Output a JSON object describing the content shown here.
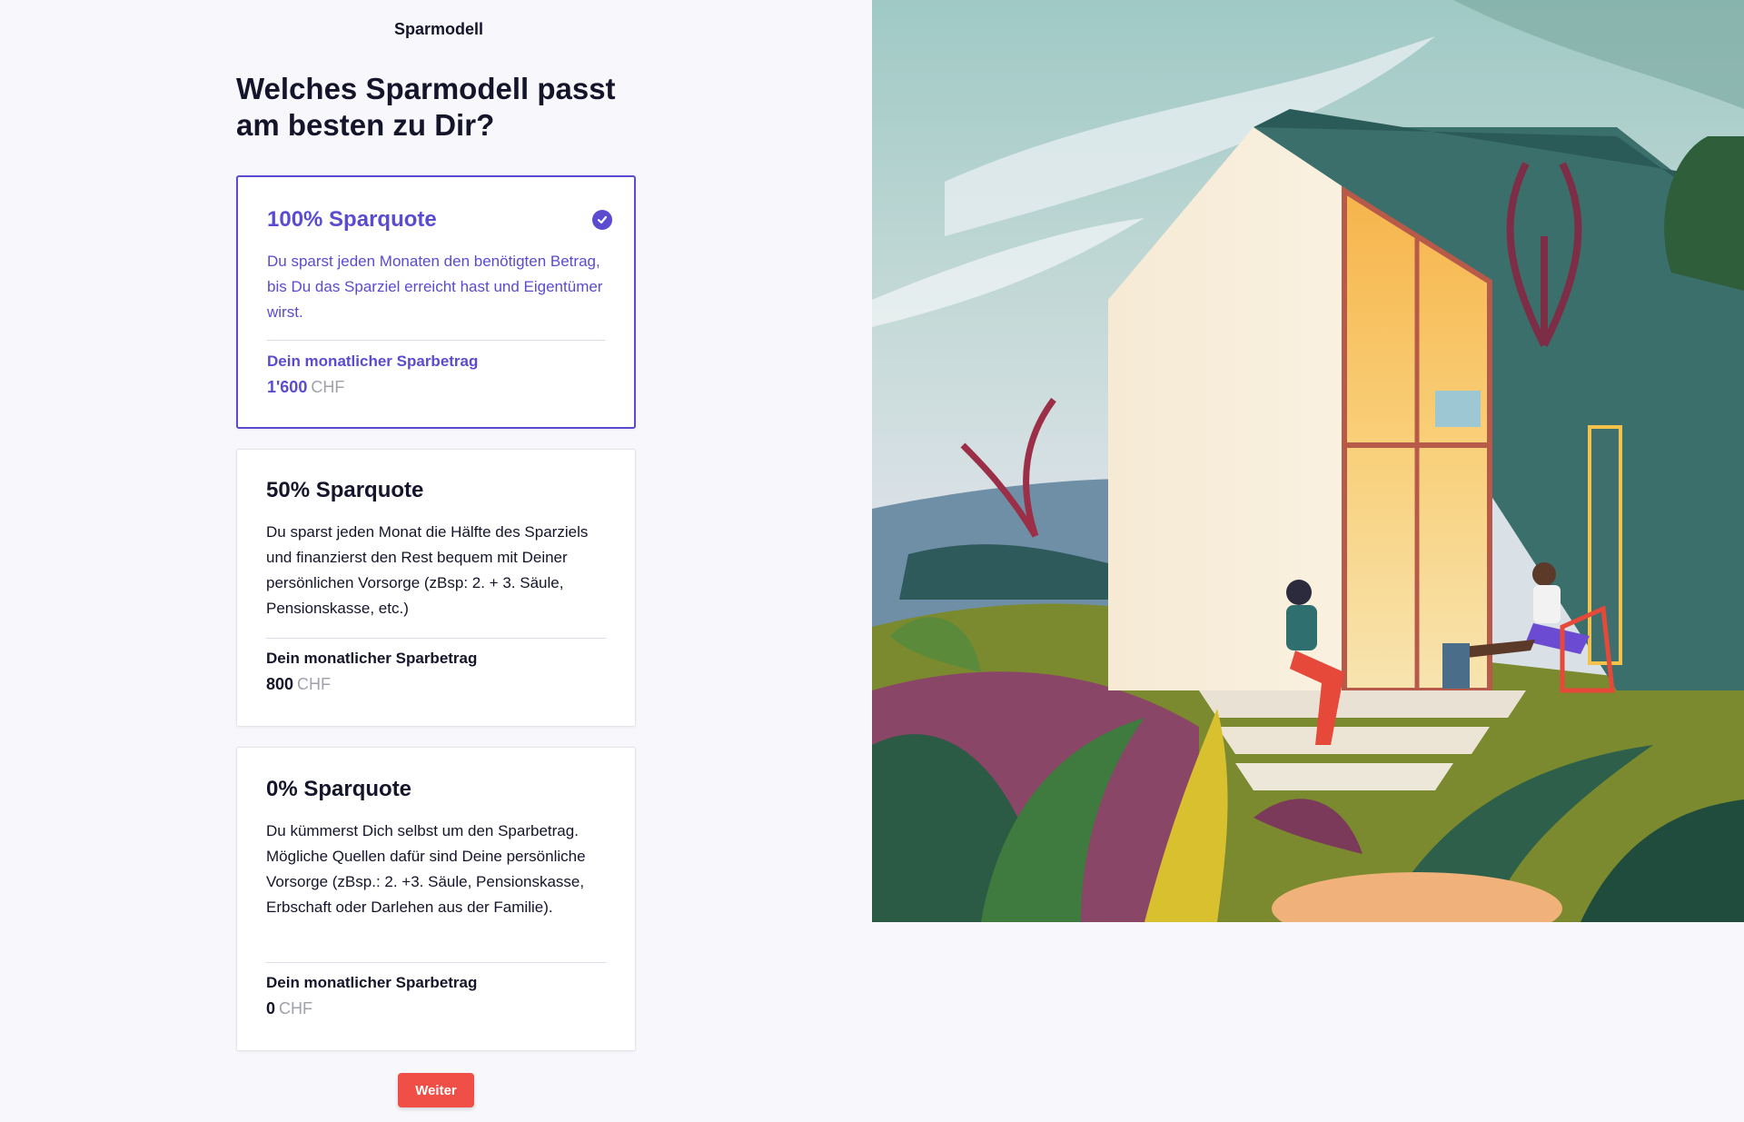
{
  "header": {
    "brand": "Sparmodell"
  },
  "main": {
    "title": "Welches Sparmodell passt am besten zu Dir?",
    "options": [
      {
        "title": "100% Sparquote",
        "description": "Du sparst jeden Monaten den benötigten Betrag, bis Du das Sparziel erreicht hast und Eigentümer wirst.",
        "amount_label": "Dein monatlicher Sparbetrag",
        "amount": "1'600",
        "currency": "CHF",
        "selected": true
      },
      {
        "title": "50% Sparquote",
        "description": "Du sparst jeden Monat die Hälfte des Sparziels und finanzierst den Rest bequem mit Deiner persönlichen Vorsorge (zBsp: 2. + 3. Säule, Pensionskasse, etc.)",
        "amount_label": "Dein monatlicher Sparbetrag",
        "amount": "800",
        "currency": "CHF",
        "selected": false
      },
      {
        "title": "0% Sparquote",
        "description": "Du kümmerst Dich selbst um den Sparbetrag. Mögliche Quellen dafür sind Deine persönliche Vorsorge (zBsp.: 2. +3. Säule, Pensionskasse, Erbschaft oder Darlehen aus der Familie).",
        "amount_label": "Dein monatlicher Sparbetrag",
        "amount": "0",
        "currency": "CHF",
        "selected": false
      }
    ],
    "next_button": "Weiter"
  },
  "colors": {
    "accent": "#5a4bd1",
    "button": "#ef4f46",
    "text": "#14142b",
    "background": "#f8f8fc"
  },
  "icons": {
    "selected": "check-circle-icon"
  }
}
